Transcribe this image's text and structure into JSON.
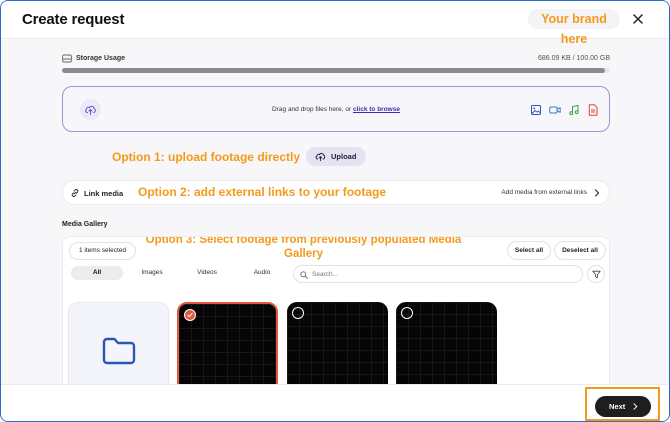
{
  "header": {
    "title": "Create request",
    "brand": "Your brand here"
  },
  "storage": {
    "label": "Storage Usage",
    "value": "686.09 KB / 100.00 GB",
    "used_fraction": 0.99
  },
  "dropzone": {
    "text": "Drag and drop files here, or ",
    "link": "click to browse",
    "type_icons": [
      "image-icon",
      "video-icon",
      "music-icon",
      "pdf-icon"
    ]
  },
  "annotations": {
    "option1": "Option 1: upload footage directly",
    "option2": "Option 2: add external links to your footage",
    "option3": "Option 3: Select footage from previously populated Media Gallery"
  },
  "upload_button": {
    "label": "Upload"
  },
  "link_media": {
    "label": "Link media",
    "action": "Add media from external links"
  },
  "gallery": {
    "title": "Media Gallery",
    "selected_count": "1 items selected",
    "select_all": "Select all",
    "deselect_all": "Deselect all",
    "tabs": [
      "All",
      "Images",
      "Videos",
      "Audio"
    ],
    "active_tab": "All",
    "search_placeholder": "Search...",
    "items": [
      {
        "kind": "folder"
      },
      {
        "kind": "video",
        "selected": true
      },
      {
        "kind": "video",
        "selected": false
      },
      {
        "kind": "video",
        "selected": false
      }
    ]
  },
  "footer": {
    "next_label": "Next"
  },
  "colors": {
    "accent_orange": "#f39a1b",
    "selection_red": "#e3573a",
    "link_purple": "#3e2bb3",
    "folder_blue": "#2d55b5"
  }
}
